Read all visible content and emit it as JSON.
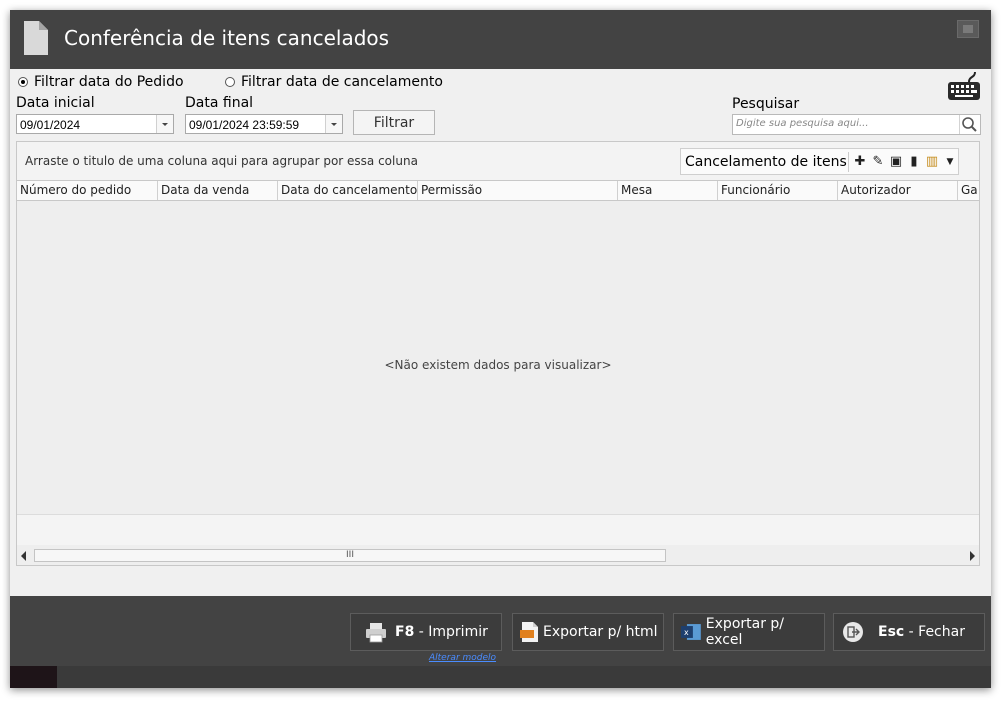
{
  "window": {
    "title": "Conferência de itens cancelados"
  },
  "filters": {
    "radio_pedido": "Filtrar data do Pedido",
    "radio_cancelamento": "Filtrar data de cancelamento",
    "selected": "pedido",
    "data_inicial_label": "Data inicial",
    "data_inicial_value": "09/01/2024",
    "data_final_label": "Data final",
    "data_final_value": "09/01/2024 23:59:59",
    "filtrar_label": "Filtrar",
    "pesquisar_label": "Pesquisar",
    "search_placeholder": "Digite sua pesquisa aqui..."
  },
  "grid": {
    "group_hint": "Arraste o titulo de uma coluna aqui para agrupar por essa coluna",
    "layout_label": "Cancelamento de itens I",
    "columns": [
      "Número do pedido",
      "Data da venda",
      "Data do cancelamento",
      "Permissão",
      "Mesa",
      "Funcionário",
      "Autorizador",
      "Ga"
    ],
    "empty_message": "<Não existem dados para visualizar>",
    "scroll_thumb_glyph": "III"
  },
  "actions": {
    "print_key": "F8",
    "print_label": " - Imprimir",
    "alterar_modelo": "Alterar modelo",
    "export_html": "Exportar p/ html",
    "export_excel": "Exportar p/ excel",
    "close_key": "Esc",
    "close_label": " - Fechar"
  },
  "colors": {
    "titlebar": "#434343",
    "background": "#f0f0f0",
    "link": "#4a8cff"
  }
}
